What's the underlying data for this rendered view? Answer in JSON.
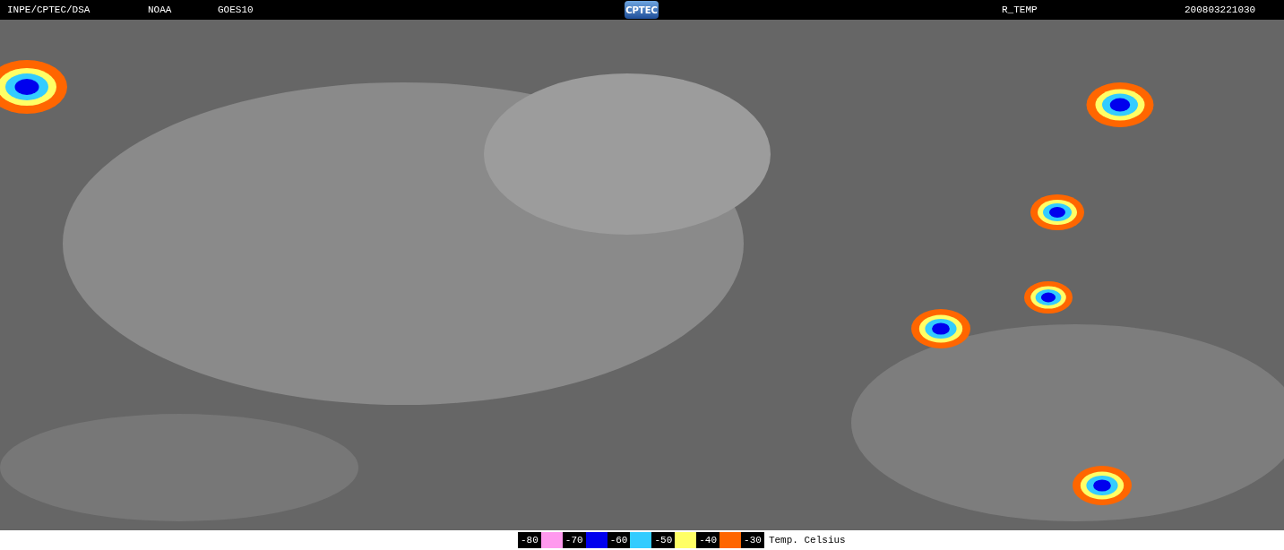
{
  "header": {
    "source": "INPE/CPTEC/DSA",
    "agency": "NOAA",
    "satellite": "GOES10",
    "logo": "CPTEC",
    "product": "R_TEMP",
    "timestamp": "200803221030"
  },
  "legend": {
    "items": [
      {
        "label": "-80",
        "color": "#ff99ee"
      },
      {
        "label": "-70",
        "color": "#0000ee"
      },
      {
        "label": "-60",
        "color": "#33ccff"
      },
      {
        "label": "-50",
        "color": "#ffff66"
      },
      {
        "label": "-40",
        "color": "#ff6600"
      },
      {
        "label": "-30"
      }
    ],
    "caption": "Temp. Celsius"
  }
}
